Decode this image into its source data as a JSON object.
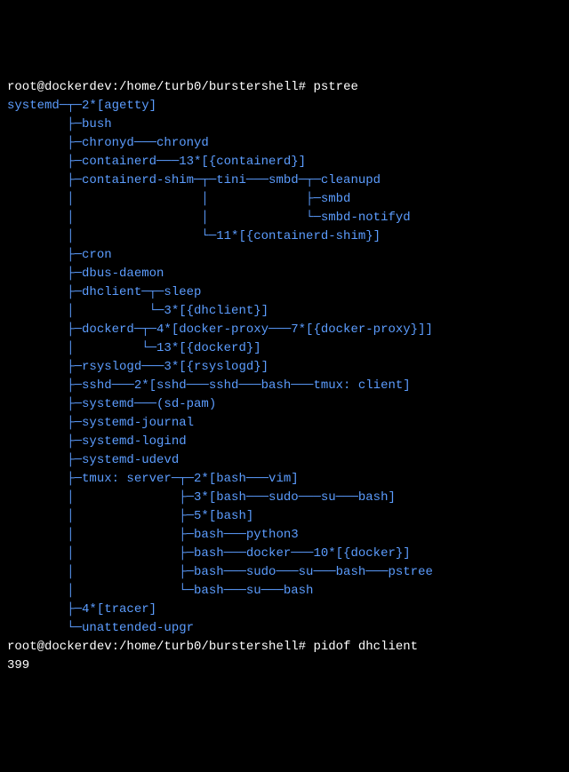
{
  "prompt1": "root@dockerdev:/home/turb0/burstershell# ",
  "cmd1": "pstree",
  "prompt2": "root@dockerdev:/home/turb0/burstershell# ",
  "cmd2": "pidof dhclient",
  "output2": "399",
  "tree": {
    "l1": "systemd─┬─2*[agetty]",
    "l2": "        ├─bush",
    "l3": "        ├─chronyd───chronyd",
    "l4": "        ├─containerd───13*[{containerd}]",
    "l5a": "        ├─containerd-shim─┬─tini───smbd─┬─cleanupd",
    "l5b": "        │                 │             ├─smbd",
    "l5c": "        │                 │             └─smbd-notifyd",
    "l5d": "        │                 └─11*[{containerd-shim}]",
    "l6": "        ├─cron",
    "l7": "        ├─dbus-daemon",
    "l8a": "        ├─dhclient─┬─sleep",
    "l8b": "        │          └─3*[{dhclient}]",
    "l9a": "        ├─dockerd─┬─4*[docker-proxy───7*[{docker-proxy}]]",
    "l9b": "        │         └─13*[{dockerd}]",
    "l10": "        ├─rsyslogd───3*[{rsyslogd}]",
    "l11": "        ├─sshd───2*[sshd───sshd───bash───tmux: client]",
    "l12": "        ├─systemd───(sd-pam)",
    "l13": "        ├─systemd-journal",
    "l14": "        ├─systemd-logind",
    "l15": "        ├─systemd-udevd",
    "l16a": "        ├─tmux: server─┬─2*[bash───vim]",
    "l16b": "        │              ├─3*[bash───sudo───su───bash]",
    "l16c": "        │              ├─5*[bash]",
    "l16d": "        │              ├─bash───python3",
    "l16e": "        │              ├─bash───docker───10*[{docker}]",
    "l16f": "        │              ├─bash───sudo───su───bash───pstree",
    "l16g": "        │              └─bash───su───bash",
    "l17": "        ├─4*[tracer]",
    "l18": "        └─unattended-upgr"
  }
}
